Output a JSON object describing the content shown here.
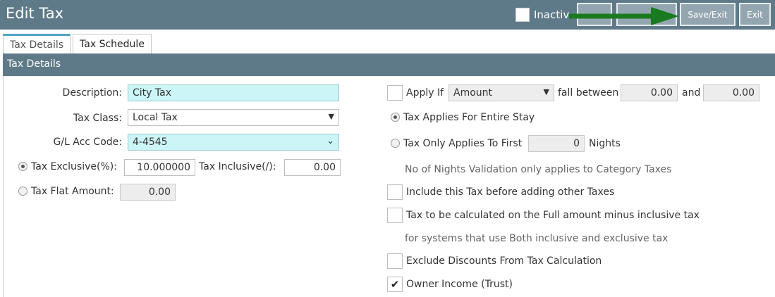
{
  "header": {
    "title": "Edit Tax",
    "inactive_label": "Inactiv",
    "buttons": {
      "btn1": "",
      "btn2": "",
      "save_exit": "Save/Exit",
      "exit": "Exit"
    },
    "arrow_color": "#1a7a1f"
  },
  "tabs": [
    {
      "label": "Tax Details"
    },
    {
      "label": "Tax Schedule"
    }
  ],
  "section": {
    "title": "Tax Details"
  },
  "left": {
    "description_label": "Description:",
    "description_value": "City Tax",
    "tax_class_label": "Tax Class:",
    "tax_class_value": "Local Tax",
    "gl_label": "G/L Acc Code:",
    "gl_value": "4-4545",
    "tax_exclusive_label": "Tax Exclusive(%):",
    "tax_exclusive_value": "10.000000",
    "tax_inclusive_label": "Tax Inclusive(/):",
    "tax_inclusive_value": "0.00",
    "tax_flat_label": "Tax Flat Amount:",
    "tax_flat_value": "0.00"
  },
  "right": {
    "apply_if_label": "Apply If",
    "apply_if_select": "Amount",
    "fall_between_label": "fall between",
    "from_value": "0.00",
    "and_label": "and",
    "to_value": "0.00",
    "entire_stay_label": "Tax Applies For Entire Stay",
    "first_label": "Tax Only Applies To First",
    "first_value": "0",
    "nights_label": "Nights",
    "nights_note": "No of Nights Validation only applies to Category Taxes",
    "include_before_label": "Include this Tax before adding other Taxes",
    "full_amount_label": "Tax to be calculated on the Full amount minus inclusive tax",
    "full_amount_note": "for systems that use Both inclusive and exclusive tax",
    "exclude_discounts_label": "Exclude Discounts From Tax Calculation",
    "owner_income_label": "Owner Income (Trust)",
    "owner_income_mark": "✔"
  }
}
